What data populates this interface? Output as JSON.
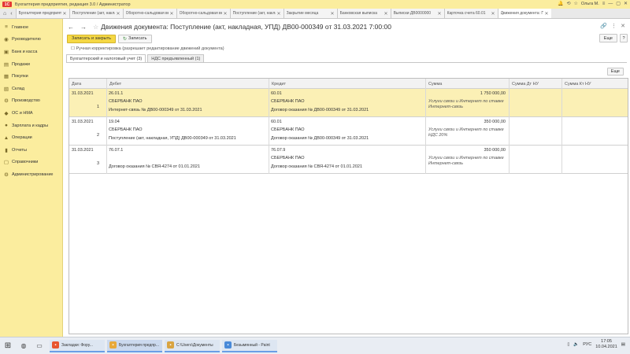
{
  "app": {
    "logo": "1С",
    "title": "Бухгалтерия предприятия, редакция 3.0 / Администратор",
    "user": "Ольга М."
  },
  "tabs": [
    {
      "label": "Бухгалтерия предприятия",
      "active": false
    },
    {
      "label": "Поступление (акт, накладная)",
      "active": false
    },
    {
      "label": "Оборотно-сальдовая ведомость",
      "active": false
    },
    {
      "label": "Оборотно-сальдовая ведомость",
      "active": false
    },
    {
      "label": "Поступление (акт, накладная)",
      "active": false
    },
    {
      "label": "Закрытие месяца",
      "active": false
    },
    {
      "label": "Банковская выписка",
      "active": false
    },
    {
      "label": "Выписки ДВ0000000",
      "active": false
    },
    {
      "label": "Карточка счета 60.01",
      "active": false
    },
    {
      "label": "Движения документа: П...",
      "active": true
    }
  ],
  "sidebar": [
    {
      "icon": "≡",
      "icon_name": "menu-icon",
      "label": "Главное"
    },
    {
      "icon": "◉",
      "icon_name": "ruble-icon",
      "label": "Руководителю"
    },
    {
      "icon": "▣",
      "icon_name": "bank-icon",
      "label": "Банк и касса"
    },
    {
      "icon": "▤",
      "icon_name": "cart-icon",
      "label": "Продажи"
    },
    {
      "icon": "▦",
      "icon_name": "basket-icon",
      "label": "Покупки"
    },
    {
      "icon": "▧",
      "icon_name": "warehouse-icon",
      "label": "Склад"
    },
    {
      "icon": "⚙",
      "icon_name": "production-icon",
      "label": "Производство"
    },
    {
      "icon": "◆",
      "icon_name": "assets-icon",
      "label": "ОС и НМА"
    },
    {
      "icon": "●",
      "icon_name": "salary-icon",
      "label": "Зарплата и кадры"
    },
    {
      "icon": "▲",
      "icon_name": "operations-icon",
      "label": "Операции"
    },
    {
      "icon": "▮",
      "icon_name": "reports-icon",
      "label": "Отчеты"
    },
    {
      "icon": "▢",
      "icon_name": "catalog-icon",
      "label": "Справочники"
    },
    {
      "icon": "⚙",
      "icon_name": "settings-icon",
      "label": "Администрирование"
    }
  ],
  "header": {
    "back": "←",
    "forward": "→",
    "title": "Движения документа: Поступление (акт, накладная, УПД) ДВ00-000349 от 31.03.2021 7:00:00"
  },
  "toolbar": {
    "close_label": "Записать и закрыть",
    "write_label": "Записать",
    "more_label": "Еще",
    "help_label": "?"
  },
  "edit_link": "Ручная корректировка (разрешает редактирование движений документа)",
  "doc_tabs": [
    {
      "label": "Бухгалтерский и налоговый учет (3)",
      "active": true
    },
    {
      "label": "НДС предъявленный (1)",
      "active": false
    }
  ],
  "table": {
    "all_actions": "Еще",
    "columns": [
      "Дата",
      "Дебет",
      "Кредит",
      "Сумма",
      "Сумма Дт НУ",
      "Сумма Кт НУ"
    ],
    "rows": [
      {
        "date": "31.03.2021",
        "index": "1",
        "debit": [
          "26.01.1",
          "СБЕРБАНК ПАО",
          "Интернет-связь № ДВ00-000349 от 31.03.2021"
        ],
        "credit": [
          "60.01",
          "СБЕРБАНК ПАО",
          "Договор оказания № ДВ00-000349 от 31.03.2021"
        ],
        "amount": "1 750 000,00",
        "note": "Услуги связи и Интернет по ставке Интернет-связь",
        "selected": true
      },
      {
        "date": "31.03.2021",
        "index": "2",
        "debit": [
          "19.04",
          "СБЕРБАНК ПАО",
          "Поступление (акт, накладная, УПД) ДВ00-000349 от 31.03.2021"
        ],
        "credit": [
          "60.01",
          "СБЕРБАНК ПАО",
          "Договор оказания № ДВ00-000349 от 31.03.2021"
        ],
        "amount": "350 000,00",
        "note": "Услуги связи и Интернет по ставке НДС 20%",
        "selected": false
      },
      {
        "date": "31.03.2021",
        "index": "3",
        "debit": [
          "76.07.1",
          "",
          "Договор оказания № СВЯ-4274 от 01.01.2021"
        ],
        "credit": [
          "76.07.9",
          "СБЕРБАНК ПАО",
          "Договор оказания № СВЯ-4274 от 01.01.2021"
        ],
        "amount": "350 000,00",
        "note": "Услуги связи и Интернет по ставке Интернет-связь",
        "selected": false
      }
    ]
  },
  "taskbar": {
    "start": "⊞",
    "apps": [
      {
        "label": "Закладки: Фору...",
        "color": "#e8542f",
        "active": false
      },
      {
        "label": "Бухгалтерия предпр...",
        "color": "#e8a93a",
        "active": true
      },
      {
        "label": "C:\\Users\\Документы",
        "color": "#d9a441",
        "active": false
      },
      {
        "label": "Безымянный - Paint",
        "color": "#4a8ad8",
        "active": false
      }
    ],
    "clock_time": "17:05",
    "clock_date": "10.04.2021",
    "lang": "РУС"
  }
}
